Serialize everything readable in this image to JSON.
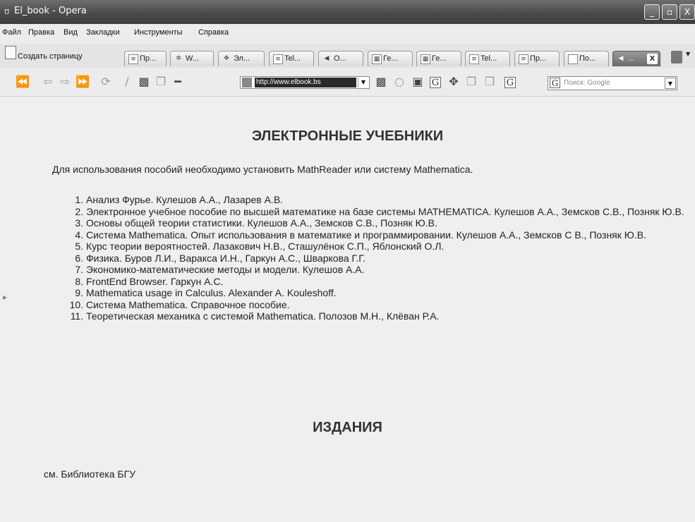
{
  "window": {
    "title": "El_book - Opera",
    "buttons": [
      "_",
      "▫",
      "X"
    ]
  },
  "menu": [
    "Файл",
    "Правка",
    "Вид",
    "Закладки",
    "Инструменты",
    "Справка"
  ],
  "tabbar": {
    "new_tab_label": "Создать страницу",
    "tabs": [
      {
        "label": "Пр...",
        "icon": "page-icon"
      },
      {
        "label": "W...",
        "icon": "asterisk-icon"
      },
      {
        "label": "Эл...",
        "icon": "dingbat-icon"
      },
      {
        "label": "Tel...",
        "icon": "page-icon"
      },
      {
        "label": "О...",
        "icon": "speaker-icon"
      },
      {
        "label": "Ге...",
        "icon": "image-icon"
      },
      {
        "label": "Ге...",
        "icon": "image-icon"
      },
      {
        "label": "Tel...",
        "icon": "page-icon"
      },
      {
        "label": "Пр...",
        "icon": "page-icon"
      },
      {
        "label": "По...",
        "icon": "blank-page-icon"
      },
      {
        "label": "...",
        "icon": "speaker-icon",
        "active": true
      }
    ]
  },
  "toolbar": {
    "address": "http://www.elbook.bs",
    "search_placeholder": "Поиск: Google"
  },
  "content": {
    "heading": "ЭЛЕКТРОННЫЕ УЧЕБНИКИ",
    "intro": "Для использования пособий необходимо установить MathReader или систему Mathematica.",
    "items": [
      "Анализ Фурье. Кулешов А.А., Лазарев А.В.",
      "Электронное учебное пособие по высшей математике на базе системы MATHEMATICA. Кулешов А.А., Земсков С.В., Позняк Ю.В.",
      "Основы общей теории статистики. Кулешов А.А., Земсков С.В., Позняк Ю.В.",
      "Система Mathematica. Опыт использования в математике и программировании. Кулешов А.А., Земсков С В., Позняк Ю.В.",
      "Курс теории вероятностей. Лазакович Н.В., Сташулёнок С.П., Яблонский О.Л.",
      "Физика. Буров Л.И., Варакса И.Н., Гаркун А.С., Шваркова Г.Г.",
      "Экономико-математические методы и модели. Кулешов А.А.",
      "FrontEnd Browser. Гаркун А.С.",
      "Mathematica usage in Calculus. Alexander A. Kouleshoff.",
      "Система Mathematica. Справочное пособие.",
      "Теоретическая механика с системой Mathematica. Полозов М.Н., Клёван Р.А."
    ],
    "section2_heading": "ИЗДАНИЯ",
    "section2_text": "см. Библиотека БГУ"
  }
}
